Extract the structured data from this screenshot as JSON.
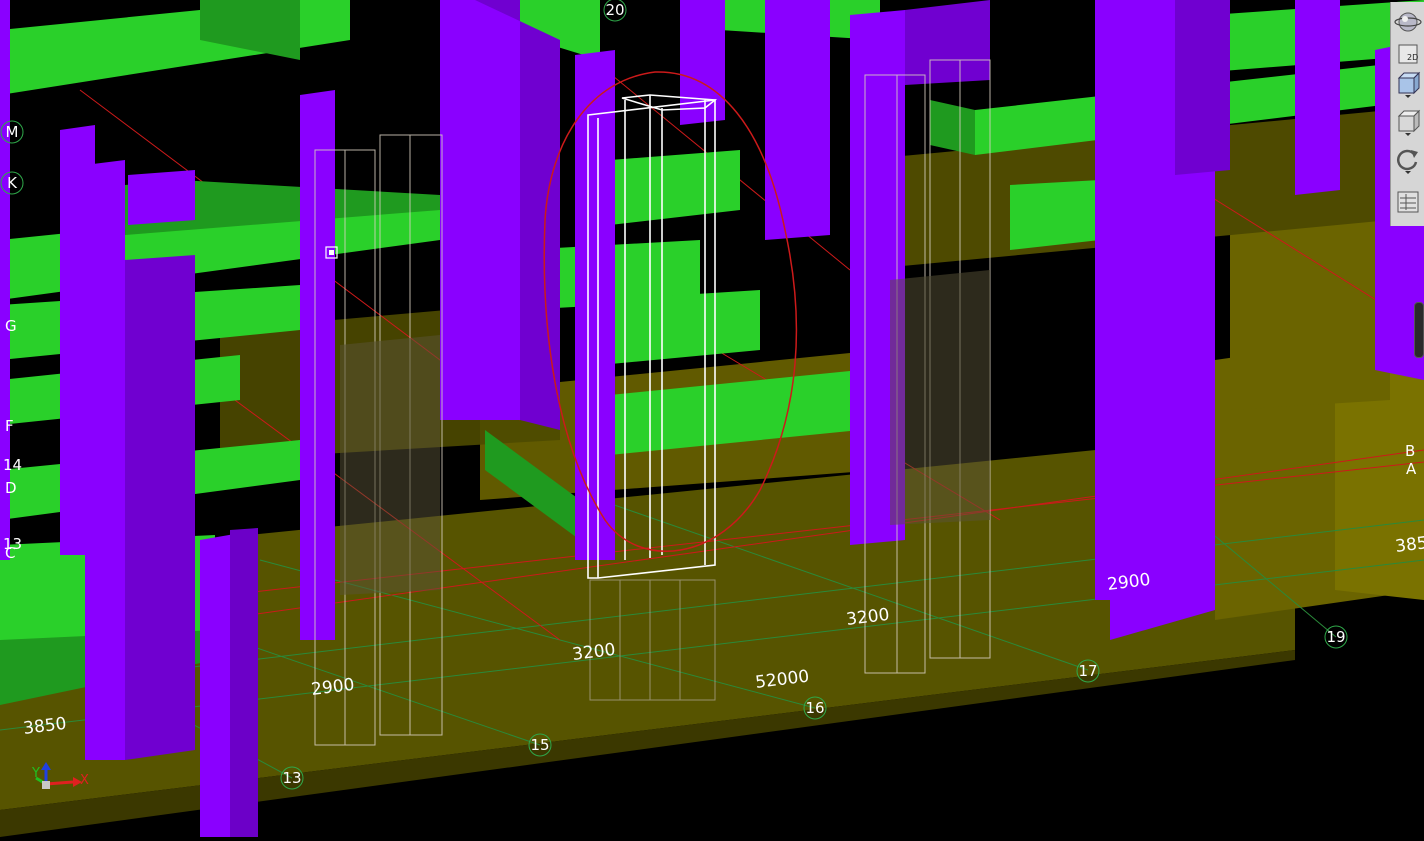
{
  "viewport": {
    "grid_bubbles": {
      "g13": "13",
      "g15": "15",
      "g16": "16",
      "g17": "17",
      "g19": "19",
      "g20": "20",
      "gM": "M",
      "gK": "K"
    },
    "side_labels": {
      "g": "G",
      "f": "F",
      "n14": "14",
      "d": "D",
      "n13": "13",
      "c": "C",
      "b": "B",
      "a": "A"
    },
    "dimensions": {
      "d2900_left": "2900",
      "d3200_mid": "3200",
      "d3200_right": "3200",
      "d2900_right": "2900",
      "d52000": "52000",
      "d3850_left": "3850",
      "d3850_right": "385"
    },
    "axis": {
      "x": "X",
      "y": "Y",
      "z": "Z"
    },
    "colors": {
      "beam": "#2ad02a",
      "column": "#8a00ff",
      "slab": "#6b6400",
      "wireframe": "#ffffff",
      "grid_line": "#2a8a3a",
      "markup": "#cc1a1a"
    }
  },
  "toolbar": {
    "view_2d_label": "2D",
    "buttons": [
      "orbit-icon",
      "view-2d-icon",
      "view-3d-icon",
      "box-icon",
      "rotate-icon",
      "settings-icon"
    ]
  }
}
